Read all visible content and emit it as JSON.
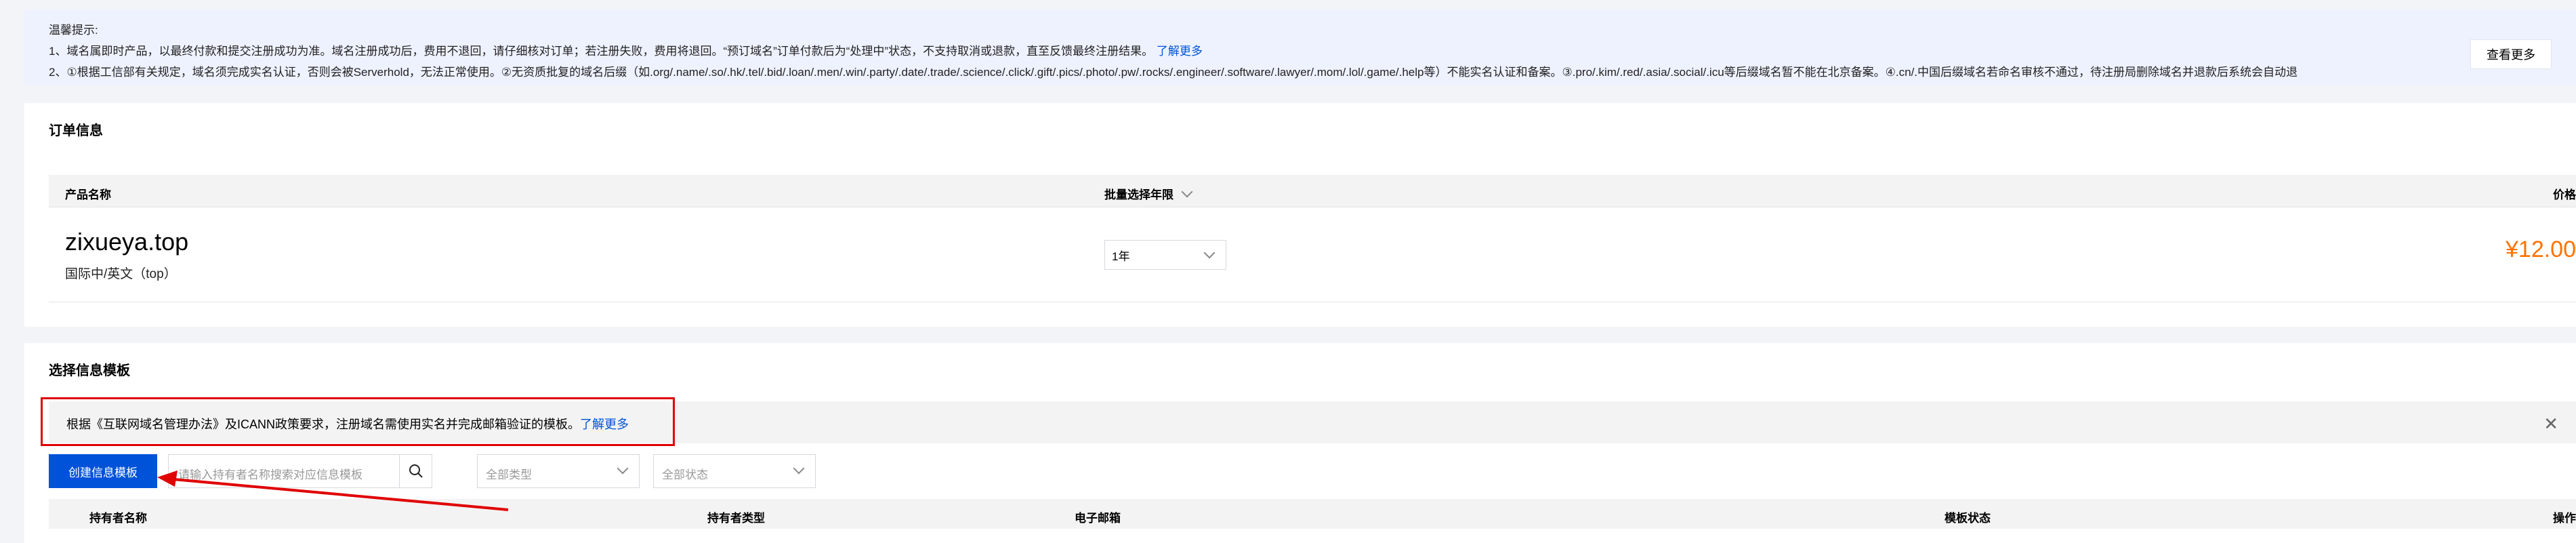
{
  "notice": {
    "title": "温馨提示:",
    "line1": "1、域名属即时产品，以最终付款和提交注册成功为准。域名注册成功后，费用不退回，请仔细核对订单；若注册失败，费用将退回。“预订域名”订单付款后为“处理中”状态，不支持取消或退款，直至反馈最终注册结果。",
    "line1_link": "了解更多",
    "line2": "2、①根据工信部有关规定，域名须完成实名认证，否则会被Serverhold，无法正常使用。②无资质批复的域名后缀（如.org/.name/.so/.hk/.tel/.bid/.loan/.men/.win/.party/.date/.trade/.science/.click/.gift/.pics/.photo/.pw/.rocks/.engineer/.software/.lawyer/.mom/.lol/.game/.help等）不能实名认证和备案。③.pro/.kim/.red/.asia/.social/.icu等后缀域名暂不能在北京备案。④.cn/.中国后缀域名若命名审核不通过，待注册局删除域名并退款后系统会自动退",
    "view_more": "查看更多"
  },
  "order": {
    "title": "订单信息",
    "columns": {
      "product": "产品名称",
      "batch": "批量选择年限",
      "price": "价格"
    },
    "item": {
      "domain": "zixueya.top",
      "type": "国际中/英文（top）",
      "years": "1年",
      "price": "¥12.00"
    }
  },
  "template": {
    "title": "选择信息模板",
    "tip": "根据《互联网域名管理办法》及ICANN政策要求，注册域名需使用实名并完成邮箱验证的模板。",
    "tip_link": "了解更多",
    "create_button": "创建信息模板",
    "search_placeholder": "请输入持有者名称搜索对应信息模板",
    "type_select": "全部类型",
    "status_select": "全部状态",
    "columns": {
      "holder_name": "持有者名称",
      "holder_type": "持有者类型",
      "email": "电子邮箱",
      "status": "模板状态",
      "actions": "操作"
    }
  },
  "colors": {
    "primary": "#0052d9",
    "price": "#ff7200",
    "annotation": "#e00000"
  }
}
